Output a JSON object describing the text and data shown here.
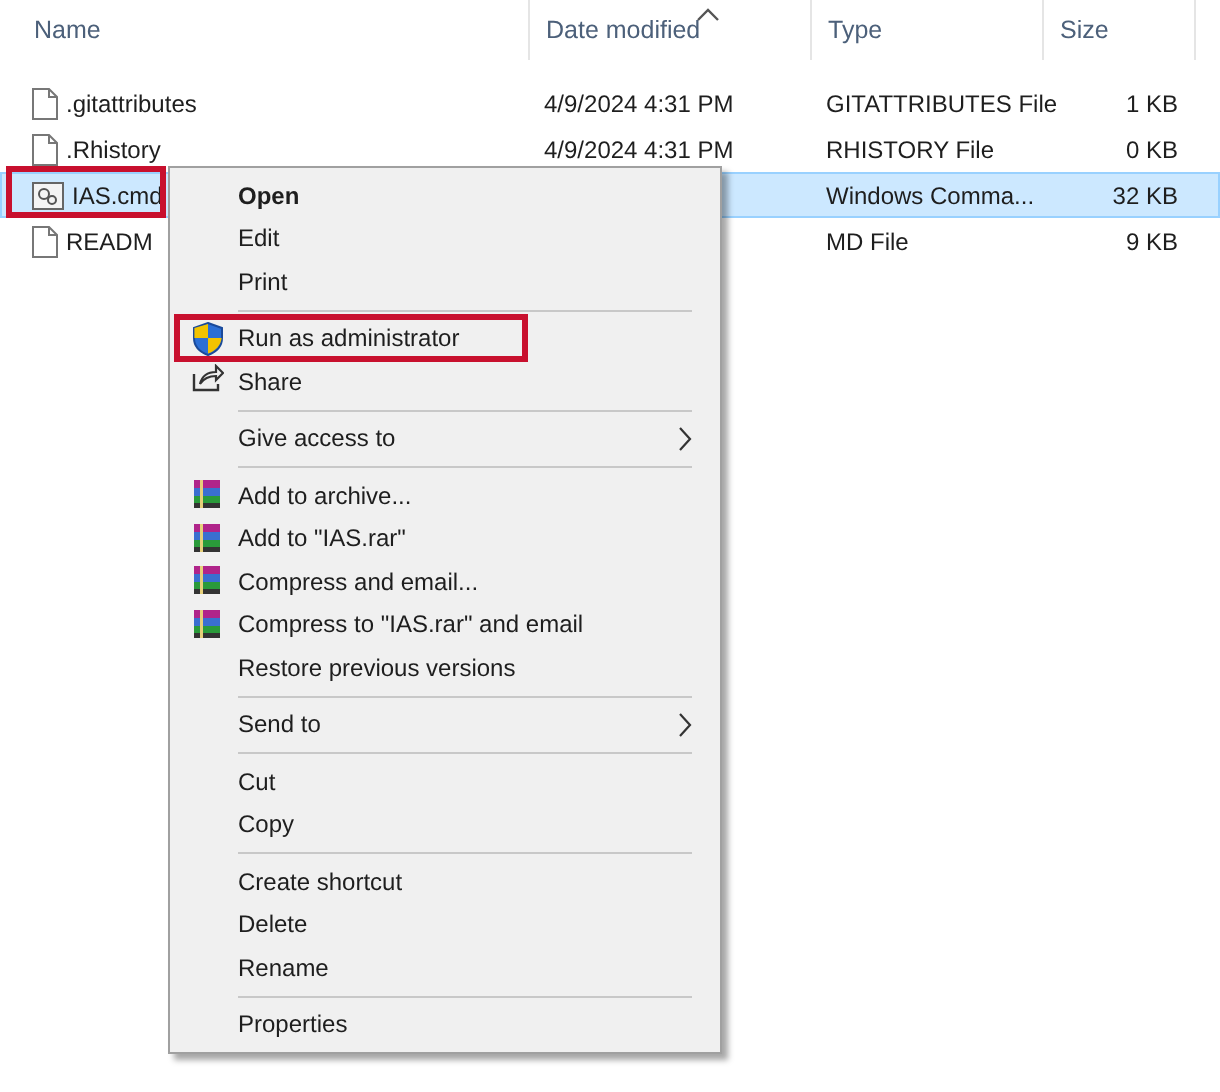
{
  "columns": [
    "Name",
    "Date modified",
    "Type",
    "Size"
  ],
  "files": [
    {
      "kind": "document",
      "name": ".gitattributes",
      "date": "4/9/2024 4:31 PM",
      "type": "GITATTRIBUTES File",
      "size": "1 KB",
      "selected": false,
      "highlighted": false
    },
    {
      "kind": "document",
      "name": ".Rhistory",
      "date": "4/9/2024 4:31 PM",
      "type": "RHISTORY File",
      "size": "0 KB",
      "selected": false,
      "highlighted": false
    },
    {
      "kind": "script",
      "name": "IAS.cmd",
      "type": "Windows Comma...",
      "size": "32 KB",
      "selected": true,
      "highlighted": true
    },
    {
      "kind": "document",
      "name": "READM",
      "type": "MD File",
      "size": "9 KB",
      "selected": false,
      "highlighted": false
    }
  ],
  "menu": {
    "items": [
      {
        "kind": "plain",
        "label": "Open",
        "default": true,
        "highlighted": false
      },
      {
        "kind": "plain",
        "label": "Edit",
        "default": false,
        "highlighted": false
      },
      {
        "kind": "plain",
        "label": "Print",
        "default": false,
        "highlighted": false
      },
      {
        "kind": "separator"
      },
      {
        "kind": "shield",
        "label": "Run as administrator",
        "default": false,
        "highlighted": true
      },
      {
        "kind": "share",
        "label": "Share",
        "default": false,
        "highlighted": false
      },
      {
        "kind": "separator"
      },
      {
        "kind": "submenu",
        "label": "Give access to",
        "default": false,
        "highlighted": false
      },
      {
        "kind": "separator"
      },
      {
        "kind": "archive",
        "label": "Add to archive...",
        "default": false,
        "highlighted": false
      },
      {
        "kind": "archive",
        "label": "Add to \"IAS.rar\"",
        "default": false,
        "highlighted": false
      },
      {
        "kind": "archive",
        "label": "Compress and email...",
        "default": false,
        "highlighted": false
      },
      {
        "kind": "archive",
        "label": "Compress to \"IAS.rar\" and email",
        "default": false,
        "highlighted": false
      },
      {
        "kind": "plain",
        "label": "Restore previous versions",
        "default": false,
        "highlighted": false
      },
      {
        "kind": "separator"
      },
      {
        "kind": "submenu",
        "label": "Send to",
        "default": false,
        "highlighted": false
      },
      {
        "kind": "separator"
      },
      {
        "kind": "plain",
        "label": "Cut",
        "default": false,
        "highlighted": false
      },
      {
        "kind": "plain",
        "label": "Copy",
        "default": false,
        "highlighted": false
      },
      {
        "kind": "separator"
      },
      {
        "kind": "plain",
        "label": "Create shortcut",
        "default": false,
        "highlighted": false
      },
      {
        "kind": "plain",
        "label": "Delete",
        "default": false,
        "highlighted": false
      },
      {
        "kind": "plain",
        "label": "Rename",
        "default": false,
        "highlighted": false
      },
      {
        "kind": "separator"
      },
      {
        "kind": "plain",
        "label": "Properties",
        "default": false,
        "highlighted": false
      }
    ]
  }
}
